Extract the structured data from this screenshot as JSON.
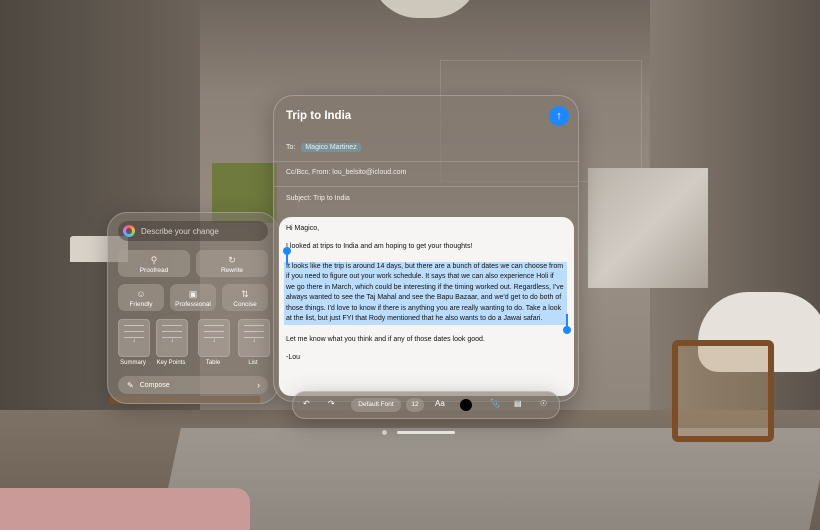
{
  "writing_tools": {
    "describe_placeholder": "Describe your change",
    "actions": [
      {
        "label": "Proofread",
        "icon": "magnifier-icon"
      },
      {
        "label": "Rewrite",
        "icon": "rewrite-icon"
      },
      {
        "label": "Friendly",
        "icon": "smile-icon"
      },
      {
        "label": "Professional",
        "icon": "briefcase-icon"
      },
      {
        "label": "Concise",
        "icon": "concise-icon"
      }
    ],
    "formats": [
      "Summary",
      "Key Points",
      "Table",
      "List"
    ],
    "compose_label": "Compose"
  },
  "mail": {
    "title": "Trip to India",
    "to_label": "To:",
    "to_recipient": "Magico Martinez",
    "cc_from": "Cc/Bcc, From: lou_belsito@icloud.com",
    "subject": "Subject: Trip to India",
    "greeting": "Hi Magico,",
    "intro": "I looked at trips to India and am hoping to get your thoughts!",
    "selected_paragraph": "It looks like the trip is around 14 days, but there are a bunch of dates we can choose from if you need to figure out your work schedule. It says that we can also experience Holi if we go there in March, which could be interesting if the timing worked out. Regardless, I've always wanted to see the Taj Mahal and see the Bapu Bazaar, and we'd get to do both of those things. I'd love to know if there is anything you are really wanting to do. Take a look at the list, but just FYI that Rody mentioned that he also wants to do a Jawai safari.",
    "closing": "Let me know what you think and if any of those dates look good.",
    "signature": "-Lou"
  },
  "toolbar": {
    "font": "Default Font",
    "size": "12",
    "text_style": "Aa",
    "color": "#000000"
  }
}
